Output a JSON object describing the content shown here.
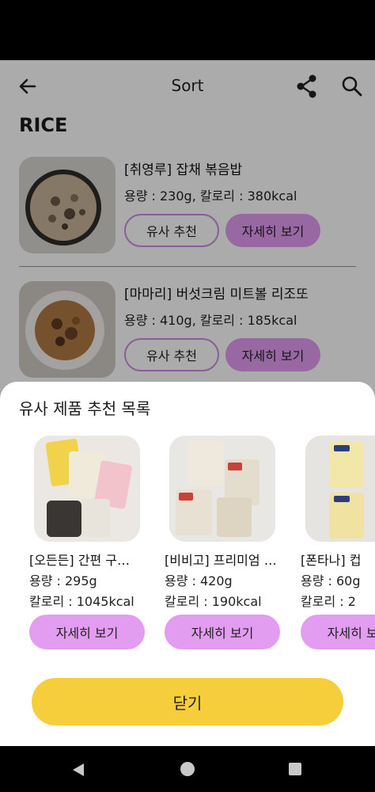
{
  "app_bar": {
    "title": "Sort",
    "back_icon": "arrow-left-icon",
    "share_icon": "share-icon",
    "search_icon": "search-icon"
  },
  "section": {
    "title": "RICE"
  },
  "products": [
    {
      "name": "[취영루] 잡채 볶음밥",
      "spec": "용량 : 230g, 칼로리 : 380kcal",
      "similar_label": "유사 추천",
      "detail_label": "자세히 보기"
    },
    {
      "name": "[마마리] 버섯크림 미트볼 리조또",
      "spec": "용량 : 410g, 칼로리 : 185kcal",
      "similar_label": "유사 추천",
      "detail_label": "자세히 보기"
    }
  ],
  "sheet": {
    "title": "유사 제품 추천 목록",
    "items": [
      {
        "name": "[오든든] 간편 구…",
        "volume": "용량 : 295g",
        "calorie": "칼로리 : 1045kcal",
        "detail_label": "자세히 보기"
      },
      {
        "name": "[비비고] 프리미엄 …",
        "volume": "용량 : 420g",
        "calorie": "칼로리 : 190kcal",
        "detail_label": "자세히 보기"
      },
      {
        "name": "[폰타나] 컵",
        "volume": "용량 : 60g",
        "calorie": "칼로리 : 2",
        "detail_label": "자세히 보기"
      }
    ],
    "close_label": "닫기"
  },
  "colors": {
    "accent_purple": "#e29cf0",
    "outline_purple": "#c98ee0",
    "close_yellow": "#f6cd3b"
  }
}
